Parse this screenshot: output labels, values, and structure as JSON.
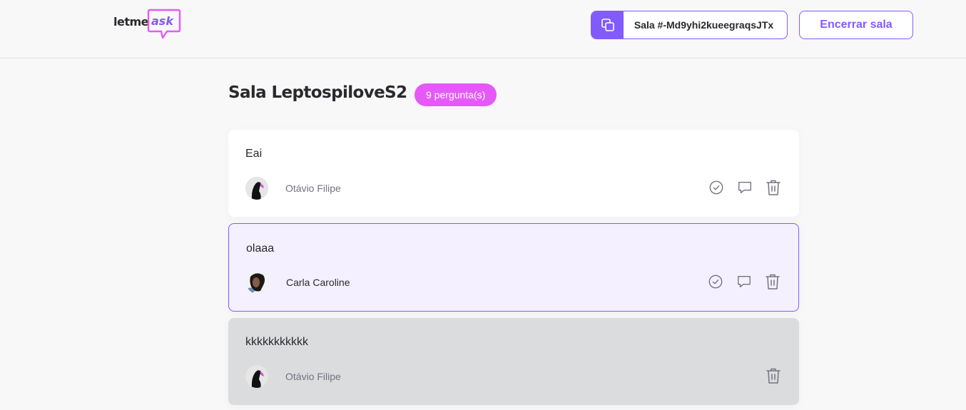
{
  "header": {
    "logo_text_prefix": "letme",
    "logo_text_accent": "ask",
    "room_code_label": "Sala #-Md9yhi2kueegraqsJTx",
    "close_room_label": "Encerrar sala"
  },
  "room": {
    "title": "Sala LeptospiloveS2",
    "question_count": "9 pergunta(s)"
  },
  "questions": [
    {
      "content": "Eai",
      "author": "Otávio Filipe",
      "state": "default",
      "actions": [
        "check-circle-icon",
        "answer-icon",
        "trash-icon"
      ]
    },
    {
      "content": "olaaa",
      "author": "Carla Caroline",
      "state": "highlighted",
      "actions": [
        "check-circle-icon",
        "answer-icon",
        "trash-icon"
      ]
    },
    {
      "content": "kkkkkkkkkkk",
      "author": "Otávio Filipe",
      "state": "answered",
      "actions": [
        "trash-icon"
      ]
    }
  ],
  "colors": {
    "accent": "#835afd",
    "badge": "#e559f9",
    "highlight_bg": "#f4f0ff",
    "answered_bg": "#dbdcdd",
    "text": "#29292e",
    "muted": "#737380"
  }
}
